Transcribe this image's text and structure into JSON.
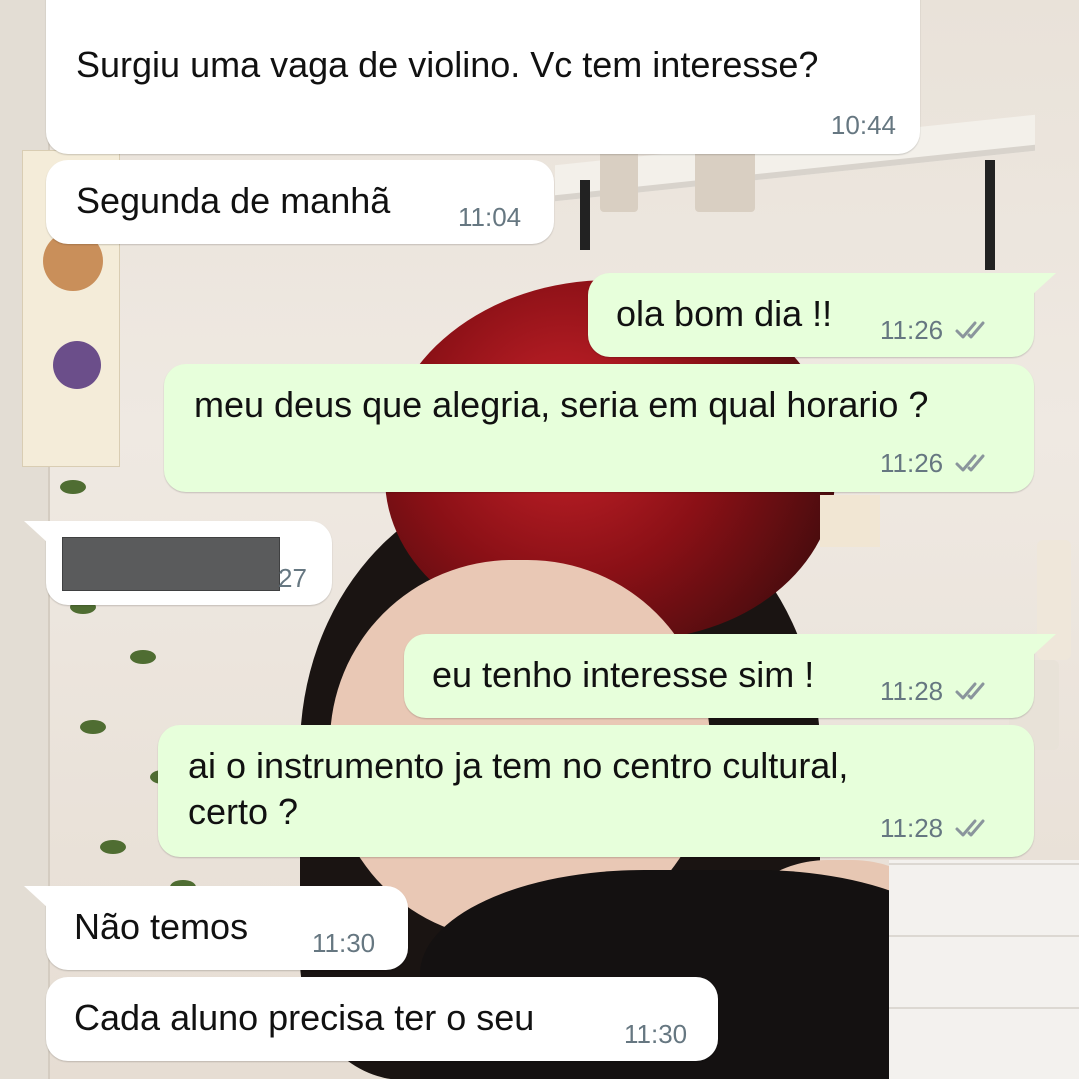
{
  "messages": [
    {
      "direction": "incoming",
      "text": "Surgiu uma vaga de violino. Vc tem interesse?",
      "time": "10:44"
    },
    {
      "direction": "incoming",
      "text": "Segunda de manhã",
      "time": "11:04"
    },
    {
      "direction": "outgoing",
      "text": "ola bom dia !!",
      "time": "11:26",
      "status_icon": "double-check-icon"
    },
    {
      "direction": "outgoing",
      "text": "meu deus que alegria, seria em qual horario ?",
      "time": "11:26",
      "status_icon": "double-check-icon"
    },
    {
      "direction": "incoming",
      "text": "",
      "time": "27",
      "redacted": true
    },
    {
      "direction": "outgoing",
      "text": "eu tenho interesse sim !",
      "time": "11:28",
      "status_icon": "double-check-icon"
    },
    {
      "direction": "outgoing",
      "text_lines": [
        "ai o instrumento ja tem no centro cultural,",
        "certo ?"
      ],
      "time": "11:28",
      "status_icon": "double-check-icon"
    },
    {
      "direction": "incoming",
      "text": "Não temos",
      "time": "11:30"
    },
    {
      "direction": "incoming",
      "text": "Cada aluno precisa ter o seu",
      "time": "11:30"
    }
  ],
  "colors": {
    "incoming_bubble": "#ffffff",
    "outgoing_bubble": "#e7ffdb",
    "timestamp": "#667781",
    "read_ticks": "#8a959c"
  }
}
